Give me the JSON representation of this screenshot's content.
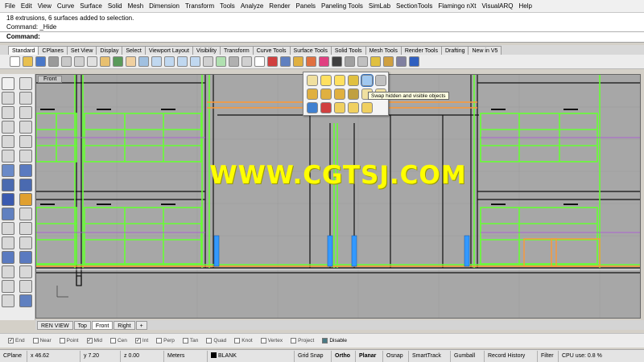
{
  "menu": [
    "File",
    "Edit",
    "View",
    "Curve",
    "Surface",
    "Solid",
    "Mesh",
    "Dimension",
    "Transform",
    "Tools",
    "Analyze",
    "Render",
    "Panels",
    "Paneling Tools",
    "SimLab",
    "SectionTools",
    "Flamingo nXt",
    "VisualARQ",
    "Help"
  ],
  "command_history": [
    "18 extrusions, 6 surfaces added to selection.",
    "Command: _Hide"
  ],
  "command_prompt": "Command:",
  "toolbar_tabs": [
    "Standard",
    "CPlanes",
    "Set View",
    "Display",
    "Select",
    "Viewport Layout",
    "Visibility",
    "Transform",
    "Curve Tools",
    "Surface Tools",
    "Solid Tools",
    "Mesh Tools",
    "Render Tools",
    "Drafting",
    "New in V5"
  ],
  "active_toolbar_tab": "Standard",
  "viewport": {
    "title": "Front",
    "watermark": "WWW.CGTSJ.COM",
    "background": "#a7a7a7"
  },
  "tooltip": "Swap hidden and visible objects",
  "viewport_tabs": [
    "REN VIEW",
    "Top",
    "Front",
    "Right"
  ],
  "active_viewport_tab": "Front",
  "add_viewport_tab": "+",
  "osnaps": [
    {
      "label": "End",
      "checked": true
    },
    {
      "label": "Near",
      "checked": false
    },
    {
      "label": "Point",
      "checked": false
    },
    {
      "label": "Mid",
      "checked": true
    },
    {
      "label": "Cen",
      "checked": false
    },
    {
      "label": "Int",
      "checked": true
    },
    {
      "label": "Perp",
      "checked": false
    },
    {
      "label": "Tan",
      "checked": false
    },
    {
      "label": "Quad",
      "checked": false
    },
    {
      "label": "Knot",
      "checked": false
    },
    {
      "label": "Vertex",
      "checked": false
    },
    {
      "label": "Project",
      "checked": false
    }
  ],
  "osnap_disable": "Disable",
  "status": {
    "cplane": "CPlane",
    "x": "x 46.62",
    "y": "y 7.20",
    "z": "z 0.00",
    "units": "Meters",
    "layer": "BLANK",
    "grid_snap": "Grid Snap",
    "ortho": "Ortho",
    "planar": "Planar",
    "osnap": "Osnap",
    "smarttrack": "SmartTrack",
    "gumball": "Gumball",
    "record_history": "Record History",
    "filter": "Filter",
    "cpu": "CPU use: 0.8 %"
  },
  "colors": {
    "green_lines": "#66ff33",
    "orange_lines": "#ff9933",
    "blue_objects": "#3399ff",
    "watermark": "#ffff00"
  }
}
